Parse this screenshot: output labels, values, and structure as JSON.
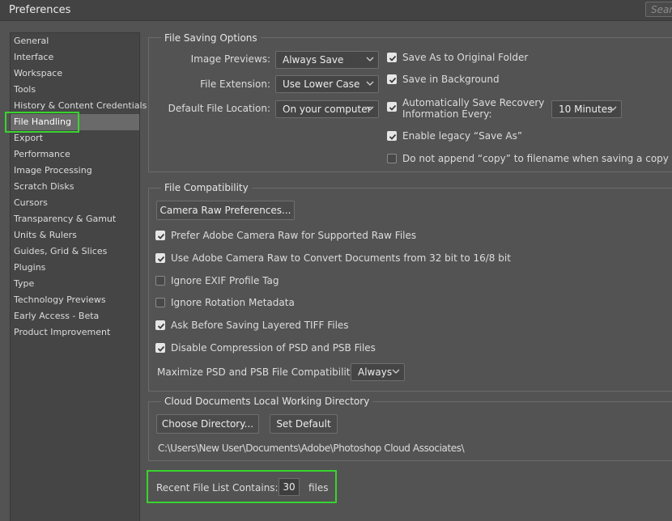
{
  "window": {
    "title": "Preferences"
  },
  "search": {
    "placeholder": "Search"
  },
  "sidebar": {
    "items": [
      {
        "label": "General"
      },
      {
        "label": "Interface"
      },
      {
        "label": "Workspace"
      },
      {
        "label": "Tools"
      },
      {
        "label": "History & Content Credentials"
      },
      {
        "label": "File Handling",
        "selected": true
      },
      {
        "label": "Export"
      },
      {
        "label": "Performance"
      },
      {
        "label": "Image Processing"
      },
      {
        "label": "Scratch Disks"
      },
      {
        "label": "Cursors"
      },
      {
        "label": "Transparency & Gamut"
      },
      {
        "label": "Units & Rulers"
      },
      {
        "label": "Guides, Grid & Slices"
      },
      {
        "label": "Plugins"
      },
      {
        "label": "Type"
      },
      {
        "label": "Technology Previews"
      },
      {
        "label": "Early Access - Beta"
      },
      {
        "label": "Product Improvement"
      }
    ]
  },
  "file_saving": {
    "title": "File Saving Options",
    "image_previews_label": "Image Previews:",
    "image_previews_value": "Always Save",
    "file_extension_label": "File Extension:",
    "file_extension_value": "Use Lower Case",
    "default_location_label": "Default File Location:",
    "default_location_value": "On your computer",
    "save_as_original": {
      "label": "Save As to Original Folder",
      "checked": true
    },
    "save_background": {
      "label": "Save in Background",
      "checked": true
    },
    "auto_recovery": {
      "label_line1": "Automatically Save Recovery",
      "label_line2": "Information Every:",
      "checked": true
    },
    "auto_recovery_interval": "10 Minutes",
    "legacy_save_as": {
      "label": "Enable legacy “Save As”",
      "checked": true
    },
    "no_copy_append": {
      "label": "Do not append “copy” to filename when saving a copy",
      "checked": false
    }
  },
  "file_compat": {
    "title": "File Compatibility",
    "camera_raw_prefs_button": "Camera Raw Preferences...",
    "options": [
      {
        "label": "Prefer Adobe Camera Raw for Supported Raw Files",
        "checked": true
      },
      {
        "label": "Use Adobe Camera Raw to Convert Documents from 32 bit to 16/8 bit",
        "checked": true
      },
      {
        "label": "Ignore EXIF Profile Tag",
        "checked": false
      },
      {
        "label": "Ignore Rotation Metadata",
        "checked": false
      },
      {
        "label": "Ask Before Saving Layered TIFF Files",
        "checked": true
      },
      {
        "label": "Disable Compression of PSD and PSB Files",
        "checked": true
      }
    ],
    "maximize_label": "Maximize PSD and PSB File Compatibility:",
    "maximize_value": "Always"
  },
  "cloud_docs": {
    "title": "Cloud Documents Local Working Directory",
    "choose_button": "Choose Directory...",
    "default_button": "Set Default",
    "path": "C:\\Users\\New User\\Documents\\Adobe\\Photoshop Cloud Associates\\"
  },
  "recent_files": {
    "label": "Recent File List Contains:",
    "value": "30",
    "suffix": "files"
  },
  "colors": {
    "highlight": "#39d32f",
    "background": "#535353"
  }
}
